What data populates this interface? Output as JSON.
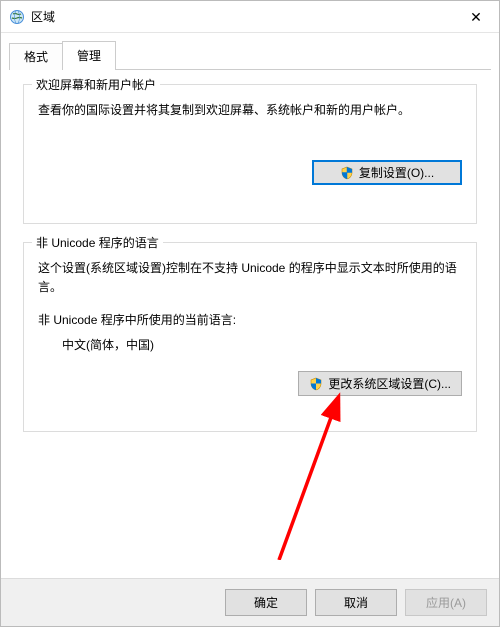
{
  "window": {
    "title": "区域"
  },
  "tabs": {
    "format": "格式",
    "admin": "管理"
  },
  "group1": {
    "title": "欢迎屏幕和新用户帐户",
    "desc": "查看你的国际设置并将其复制到欢迎屏幕、系统帐户和新的用户帐户。",
    "button": "复制设置(O)..."
  },
  "group2": {
    "title": "非 Unicode 程序的语言",
    "desc": "这个设置(系统区域设置)控制在不支持 Unicode 的程序中显示文本时所使用的语言。",
    "current_label": "非 Unicode 程序中所使用的当前语言:",
    "current_value": "中文(简体，中国)",
    "button": "更改系统区域设置(C)..."
  },
  "footer": {
    "ok": "确定",
    "cancel": "取消",
    "apply": "应用(A)"
  }
}
